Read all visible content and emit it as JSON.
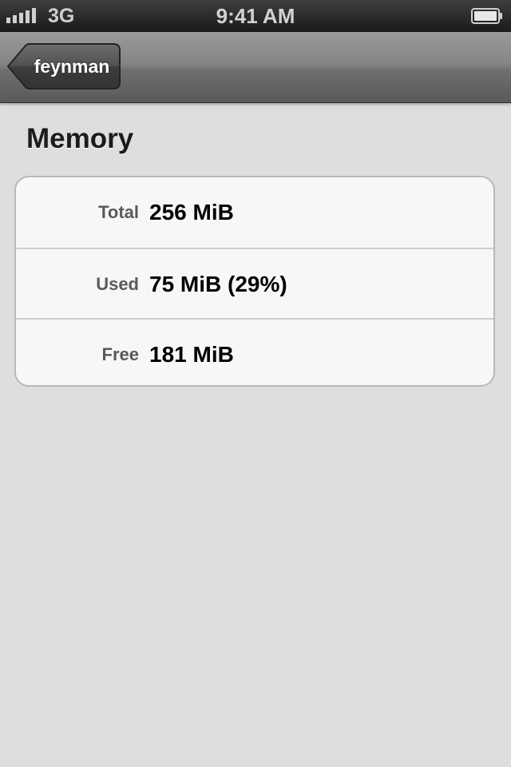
{
  "status_bar": {
    "carrier": "3G",
    "time": "9:41 AM"
  },
  "nav": {
    "back_label": "feynman"
  },
  "section": {
    "title": "Memory"
  },
  "rows": [
    {
      "key": "Total",
      "value": "256 MiB"
    },
    {
      "key": "Used",
      "value": "75 MiB (29%)"
    },
    {
      "key": "Free",
      "value": "181 MiB"
    }
  ]
}
